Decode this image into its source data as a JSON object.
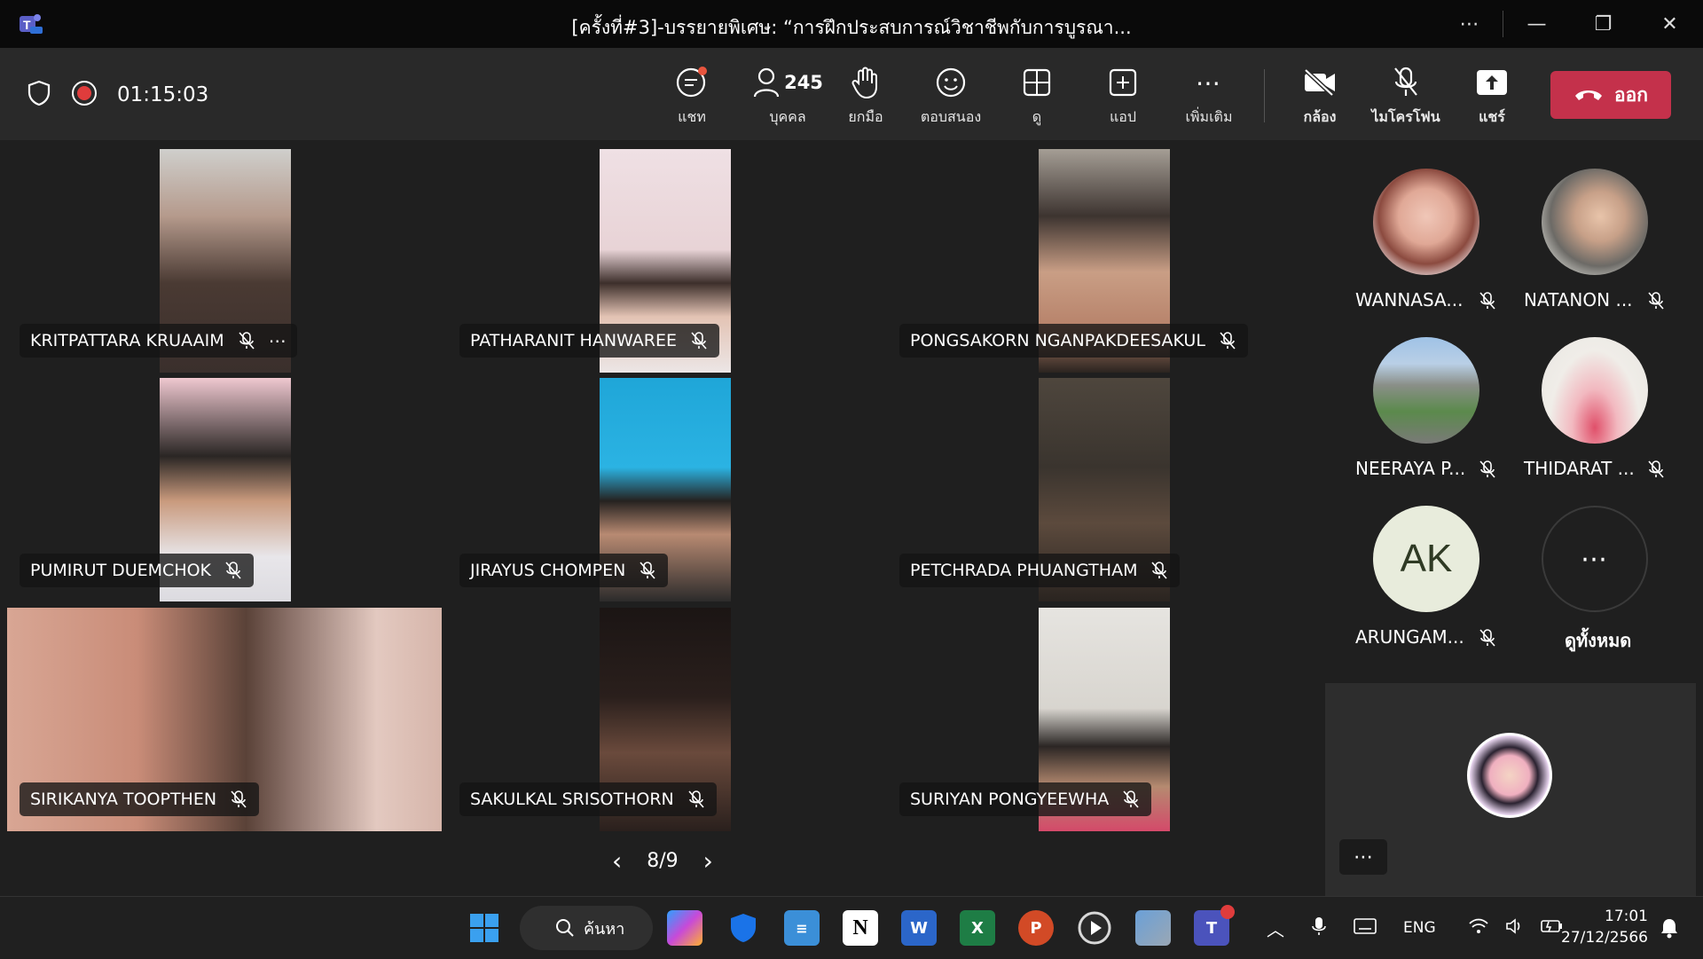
{
  "window": {
    "title": "[ครั้งที่#3]-บรรยายพิเศษ: “การฝึกประสบการณ์วิชาชีพกับการบูรณา..."
  },
  "toolbar": {
    "timer": "01:15:03",
    "chat_label": "แชท",
    "people_label": "บุคคล",
    "people_count": "245",
    "raise_label": "ยกมือ",
    "react_label": "ตอบสนอง",
    "view_label": "ดู",
    "apps_label": "แอป",
    "more_label": "เพิ่มเติม",
    "camera_label": "กล้อง",
    "mic_label": "ไมโครโฟน",
    "share_label": "แชร์",
    "leave_label": "ออก"
  },
  "participants": [
    {
      "name": "KRITPATTARA KRUAAIM"
    },
    {
      "name": "PATHARANIT HANWAREE"
    },
    {
      "name": "PONGSAKORN NGANPAKDEESAKUL"
    },
    {
      "name": "PUMIRUT DUEMCHOK"
    },
    {
      "name": "JIRAYUS CHOMPEN"
    },
    {
      "name": "PETCHRADA PHUANGTHAM"
    },
    {
      "name": "SIRIKANYA TOOPTHEN"
    },
    {
      "name": "SAKULKAL SRISOTHORN"
    },
    {
      "name": "SURIYAN PONGYEEWHA"
    }
  ],
  "side_participants": [
    {
      "name": "WANNASA..."
    },
    {
      "name": "NATANON ..."
    },
    {
      "name": "NEERAYA P..."
    },
    {
      "name": "THIDARAT ..."
    },
    {
      "name": "ARUNGAM...",
      "initials": "AK"
    }
  ],
  "view_all_label": "ดูทั้งหมด",
  "pager": {
    "text": "8/9"
  },
  "taskbar": {
    "search_label": "ค้นหา",
    "lang": "ENG",
    "time": "17:01",
    "date": "27/12/2566"
  },
  "colors": {
    "leave": "#c4314b",
    "record": "#e03c3c",
    "bg": "#1f1f1f"
  }
}
